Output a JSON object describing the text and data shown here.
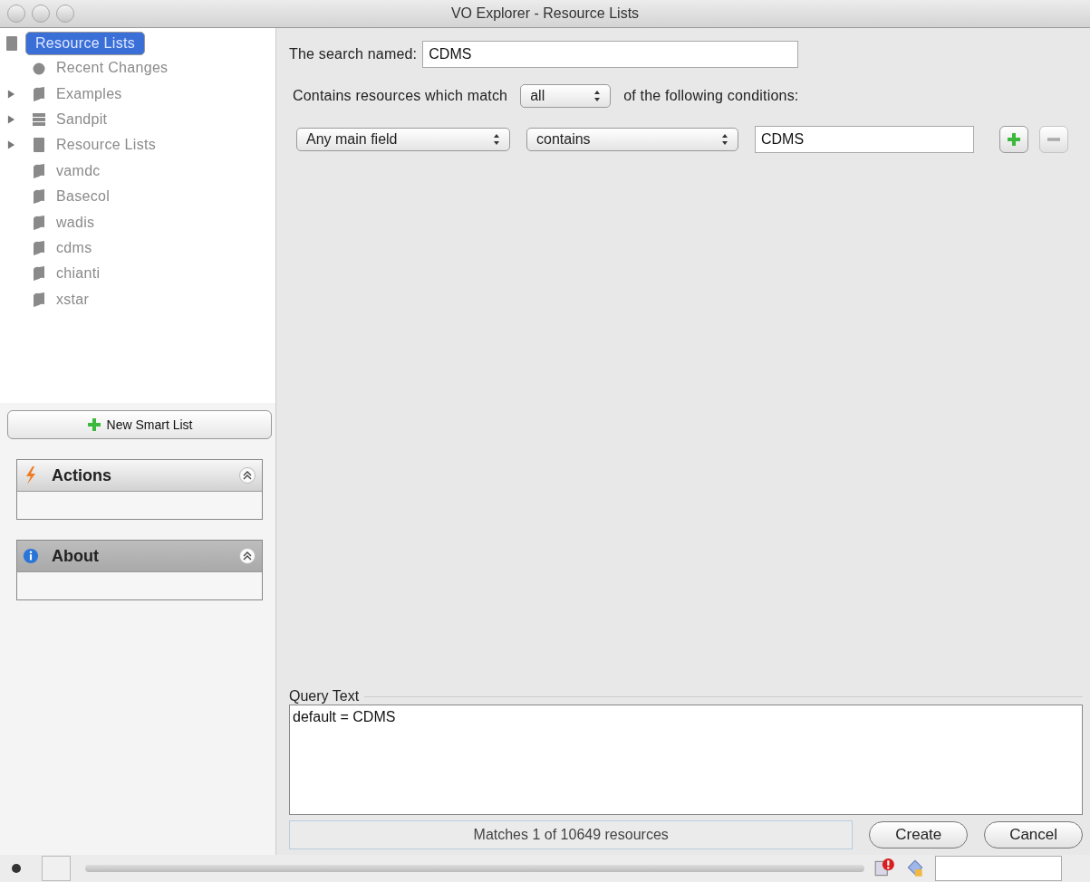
{
  "window": {
    "title": "VO Explorer - Resource Lists"
  },
  "tree": [
    {
      "label": "Resource Lists",
      "kind": "list",
      "selected": true,
      "children": [
        {
          "label": "Recent Changes",
          "kind": "recent",
          "selected": false
        },
        {
          "label": "Examples",
          "kind": "folder",
          "selected": false,
          "expanded": false
        },
        {
          "label": "Sandpit",
          "kind": "sandpit",
          "selected": false,
          "expanded": false
        },
        {
          "label": "Resource Lists",
          "kind": "list",
          "selected": false,
          "expanded": false
        },
        {
          "label": "vamdc",
          "kind": "smart",
          "selected": false
        },
        {
          "label": "Basecol",
          "kind": "smart",
          "selected": false
        },
        {
          "label": "wadis",
          "kind": "smart",
          "selected": false
        },
        {
          "label": "cdms",
          "kind": "smart",
          "selected": false
        },
        {
          "label": "chianti",
          "kind": "smart",
          "selected": false
        },
        {
          "label": "xstar",
          "kind": "smart",
          "selected": false
        }
      ]
    }
  ],
  "new_button": "New Smart List",
  "panels": [
    {
      "title": "Actions",
      "kind": "actions",
      "selected": false
    },
    {
      "title": "About",
      "kind": "about",
      "selected": true
    }
  ],
  "search_name": {
    "label": "The search named:",
    "value": "CDMS"
  },
  "match": {
    "before": "Contains resources which match",
    "value": "all",
    "after": "of the following conditions:"
  },
  "conditions": [
    {
      "field": "Any main field",
      "operator": "contains",
      "value": "CDMS"
    }
  ],
  "query": {
    "label": "Query Text",
    "value": "default = CDMS"
  },
  "status": "Matches 1 of 10649 resources",
  "buttons": [
    "Create",
    "Cancel"
  ],
  "status_bar": {
    "progress": {
      "level": 0
    }
  }
}
